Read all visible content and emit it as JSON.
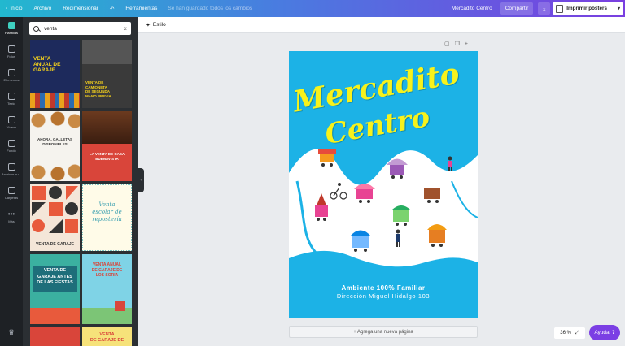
{
  "topbar": {
    "home_label": "Inicio",
    "file_label": "Archivo",
    "resize_label": "Redimensionar",
    "tools_label": "Herramientas",
    "saved_status": "Se han guardado todos los cambios",
    "design_title": "Mercadito Centro",
    "share_label": "Compartir",
    "print_label": "Imprimir pósters"
  },
  "rail": {
    "items": [
      "Plantillas",
      "Fotos",
      "Elementos",
      "Texto",
      "Vídeos",
      "Fondo",
      "Archivos su...",
      "Carpetas",
      "Más"
    ]
  },
  "search": {
    "value": "venta"
  },
  "templates": [
    {
      "lines": [
        "VENTA",
        "ANUAL DE",
        "GARAJE"
      ]
    },
    {
      "lines": [
        "VENTA DE",
        "CAMIONETA",
        "DE SEGUNDA",
        "MANO PREVIA"
      ]
    },
    {
      "lines": [
        "AHORA, GALLETAS",
        "DISPONIBLES"
      ]
    },
    {
      "lines": [
        "LA VENTA DE CASA",
        "BUENAVISTA"
      ]
    },
    {
      "lines": [
        "VENTA DE GARAJE"
      ]
    },
    {
      "lines": [
        "Venta",
        "escolar de",
        "repostería"
      ]
    },
    {
      "lines": [
        "VENTA DE",
        "GARAJE ANTES",
        "DE LAS FIESTAS"
      ]
    },
    {
      "lines": [
        "VENTA ANUAL",
        "DE GARAJE DE",
        "LOS SORIA"
      ]
    },
    {
      "lines": []
    },
    {
      "lines": [
        "VENTA",
        "DE GARAJE DE"
      ]
    }
  ],
  "subbar": {
    "style_label": "Estilo"
  },
  "poster": {
    "title_line1": "Mercadito",
    "title_line2": "Centro",
    "subtitle": "Ambiente 100% Familiar",
    "address": "Dirección Miguel Hidalgo 103",
    "colors": {
      "background": "#1cb2e6",
      "title": "#f7f21c",
      "wave": "#ffffff"
    }
  },
  "add_page_label": "+ Agrega una nueva página",
  "zoom_label": "36 %",
  "help_label": "Ayuda",
  "help_icon": "?",
  "colors": {
    "accent": "#7b3fe4",
    "rail": "#1e2125",
    "panel": "#2b2f33"
  }
}
